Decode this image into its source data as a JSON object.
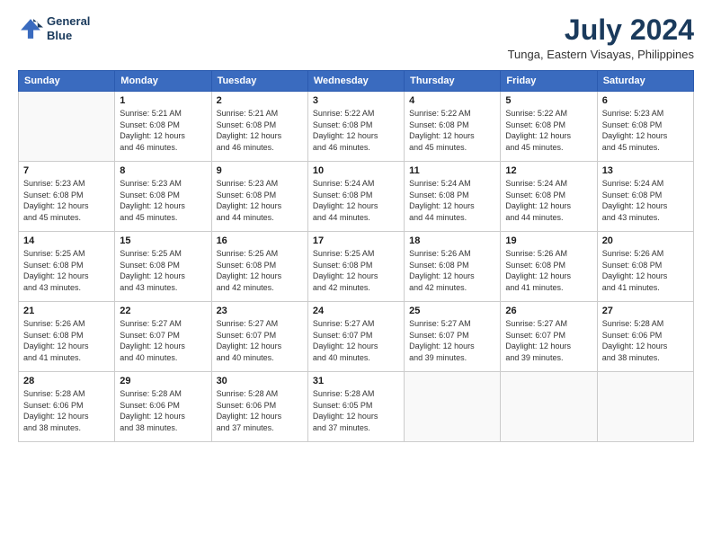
{
  "logo": {
    "line1": "General",
    "line2": "Blue"
  },
  "title": "July 2024",
  "subtitle": "Tunga, Eastern Visayas, Philippines",
  "days_of_week": [
    "Sunday",
    "Monday",
    "Tuesday",
    "Wednesday",
    "Thursday",
    "Friday",
    "Saturday"
  ],
  "weeks": [
    [
      {
        "num": "",
        "info": ""
      },
      {
        "num": "1",
        "info": "Sunrise: 5:21 AM\nSunset: 6:08 PM\nDaylight: 12 hours\nand 46 minutes."
      },
      {
        "num": "2",
        "info": "Sunrise: 5:21 AM\nSunset: 6:08 PM\nDaylight: 12 hours\nand 46 minutes."
      },
      {
        "num": "3",
        "info": "Sunrise: 5:22 AM\nSunset: 6:08 PM\nDaylight: 12 hours\nand 46 minutes."
      },
      {
        "num": "4",
        "info": "Sunrise: 5:22 AM\nSunset: 6:08 PM\nDaylight: 12 hours\nand 45 minutes."
      },
      {
        "num": "5",
        "info": "Sunrise: 5:22 AM\nSunset: 6:08 PM\nDaylight: 12 hours\nand 45 minutes."
      },
      {
        "num": "6",
        "info": "Sunrise: 5:23 AM\nSunset: 6:08 PM\nDaylight: 12 hours\nand 45 minutes."
      }
    ],
    [
      {
        "num": "7",
        "info": "Sunrise: 5:23 AM\nSunset: 6:08 PM\nDaylight: 12 hours\nand 45 minutes."
      },
      {
        "num": "8",
        "info": "Sunrise: 5:23 AM\nSunset: 6:08 PM\nDaylight: 12 hours\nand 45 minutes."
      },
      {
        "num": "9",
        "info": "Sunrise: 5:23 AM\nSunset: 6:08 PM\nDaylight: 12 hours\nand 44 minutes."
      },
      {
        "num": "10",
        "info": "Sunrise: 5:24 AM\nSunset: 6:08 PM\nDaylight: 12 hours\nand 44 minutes."
      },
      {
        "num": "11",
        "info": "Sunrise: 5:24 AM\nSunset: 6:08 PM\nDaylight: 12 hours\nand 44 minutes."
      },
      {
        "num": "12",
        "info": "Sunrise: 5:24 AM\nSunset: 6:08 PM\nDaylight: 12 hours\nand 44 minutes."
      },
      {
        "num": "13",
        "info": "Sunrise: 5:24 AM\nSunset: 6:08 PM\nDaylight: 12 hours\nand 43 minutes."
      }
    ],
    [
      {
        "num": "14",
        "info": "Sunrise: 5:25 AM\nSunset: 6:08 PM\nDaylight: 12 hours\nand 43 minutes."
      },
      {
        "num": "15",
        "info": "Sunrise: 5:25 AM\nSunset: 6:08 PM\nDaylight: 12 hours\nand 43 minutes."
      },
      {
        "num": "16",
        "info": "Sunrise: 5:25 AM\nSunset: 6:08 PM\nDaylight: 12 hours\nand 42 minutes."
      },
      {
        "num": "17",
        "info": "Sunrise: 5:25 AM\nSunset: 6:08 PM\nDaylight: 12 hours\nand 42 minutes."
      },
      {
        "num": "18",
        "info": "Sunrise: 5:26 AM\nSunset: 6:08 PM\nDaylight: 12 hours\nand 42 minutes."
      },
      {
        "num": "19",
        "info": "Sunrise: 5:26 AM\nSunset: 6:08 PM\nDaylight: 12 hours\nand 41 minutes."
      },
      {
        "num": "20",
        "info": "Sunrise: 5:26 AM\nSunset: 6:08 PM\nDaylight: 12 hours\nand 41 minutes."
      }
    ],
    [
      {
        "num": "21",
        "info": "Sunrise: 5:26 AM\nSunset: 6:08 PM\nDaylight: 12 hours\nand 41 minutes."
      },
      {
        "num": "22",
        "info": "Sunrise: 5:27 AM\nSunset: 6:07 PM\nDaylight: 12 hours\nand 40 minutes."
      },
      {
        "num": "23",
        "info": "Sunrise: 5:27 AM\nSunset: 6:07 PM\nDaylight: 12 hours\nand 40 minutes."
      },
      {
        "num": "24",
        "info": "Sunrise: 5:27 AM\nSunset: 6:07 PM\nDaylight: 12 hours\nand 40 minutes."
      },
      {
        "num": "25",
        "info": "Sunrise: 5:27 AM\nSunset: 6:07 PM\nDaylight: 12 hours\nand 39 minutes."
      },
      {
        "num": "26",
        "info": "Sunrise: 5:27 AM\nSunset: 6:07 PM\nDaylight: 12 hours\nand 39 minutes."
      },
      {
        "num": "27",
        "info": "Sunrise: 5:28 AM\nSunset: 6:06 PM\nDaylight: 12 hours\nand 38 minutes."
      }
    ],
    [
      {
        "num": "28",
        "info": "Sunrise: 5:28 AM\nSunset: 6:06 PM\nDaylight: 12 hours\nand 38 minutes."
      },
      {
        "num": "29",
        "info": "Sunrise: 5:28 AM\nSunset: 6:06 PM\nDaylight: 12 hours\nand 38 minutes."
      },
      {
        "num": "30",
        "info": "Sunrise: 5:28 AM\nSunset: 6:06 PM\nDaylight: 12 hours\nand 37 minutes."
      },
      {
        "num": "31",
        "info": "Sunrise: 5:28 AM\nSunset: 6:05 PM\nDaylight: 12 hours\nand 37 minutes."
      },
      {
        "num": "",
        "info": ""
      },
      {
        "num": "",
        "info": ""
      },
      {
        "num": "",
        "info": ""
      }
    ]
  ]
}
